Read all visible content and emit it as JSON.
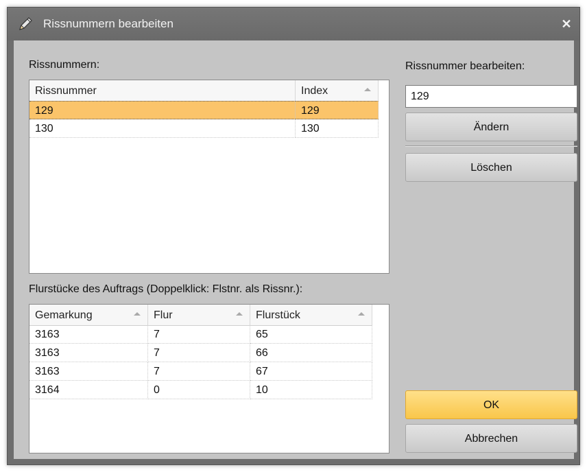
{
  "window": {
    "title": "Rissnummern bearbeiten",
    "close_glyph": "✕"
  },
  "rissnummern": {
    "label": "Rissnummern:",
    "columns": [
      "Rissnummer",
      "Index"
    ],
    "rows": [
      {
        "rissnummer": "129",
        "index": "129",
        "selected": true
      },
      {
        "rissnummer": "130",
        "index": "130",
        "selected": false
      }
    ]
  },
  "flurstuecke": {
    "label": "Flurstücke des Auftrags (Doppelklick: Flstnr. als Rissnr.):",
    "columns": [
      "Gemarkung",
      "Flur",
      "Flurstück"
    ],
    "rows": [
      {
        "gemarkung": "3163",
        "flur": "7",
        "flurstueck": "65"
      },
      {
        "gemarkung": "3163",
        "flur": "7",
        "flurstueck": "66"
      },
      {
        "gemarkung": "3163",
        "flur": "7",
        "flurstueck": "67"
      },
      {
        "gemarkung": "3164",
        "flur": "0",
        "flurstueck": "10"
      }
    ]
  },
  "edit": {
    "label": "Rissnummer bearbeiten:",
    "value": "129"
  },
  "buttons": {
    "aendern": "Ändern",
    "loeschen": "Löschen",
    "ok": "OK",
    "abbrechen": "Abbrechen"
  },
  "icons": {
    "title": "pencil-icon",
    "close": "close-icon"
  },
  "colors": {
    "selection": "#fbc46a",
    "ok_button": "#f9c64a",
    "client_bg": "#c5c5c5",
    "titlebar": "#6e6e6e"
  }
}
